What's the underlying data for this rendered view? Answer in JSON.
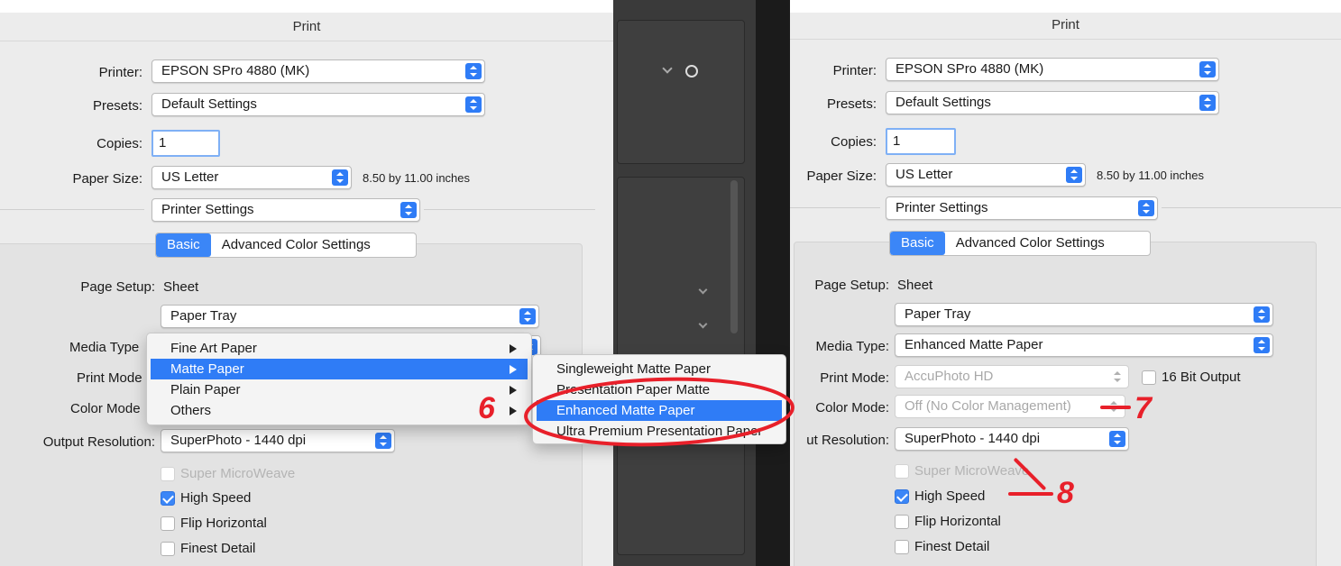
{
  "dialog_title": "Print",
  "labels": {
    "printer": "Printer:",
    "presets": "Presets:",
    "copies": "Copies:",
    "paper_size": "Paper Size:",
    "page_setup": "Page Setup:",
    "media_type": "Media Type:",
    "print_mode": "Print Mode:",
    "color_mode": "Color Mode:",
    "output_resolution": "Output Resolution:"
  },
  "left": {
    "printer": "EPSON SPro 4880 (MK)",
    "presets": "Default Settings",
    "copies": "1",
    "paper_size": "US Letter",
    "paper_dimensions": "8.50 by 11.00 inches",
    "panel_select": "Printer Settings",
    "tabs": [
      "Basic",
      "Advanced Color Settings"
    ],
    "page_setup_value": "Sheet",
    "paper_source": "Paper Tray",
    "media_type_label_clipped": "Media Type",
    "print_mode_label_clipped": "Print Mode",
    "color_mode_label_clipped": "Color Mode",
    "output_resolution": "SuperPhoto - 1440 dpi",
    "options": [
      {
        "label": "Super MicroWeave",
        "checked": false,
        "disabled": true
      },
      {
        "label": "High Speed",
        "checked": true,
        "disabled": false
      },
      {
        "label": "Flip Horizontal",
        "checked": false,
        "disabled": false
      },
      {
        "label": "Finest Detail",
        "checked": false,
        "disabled": false
      }
    ]
  },
  "media_menu": {
    "items": [
      "Fine Art Paper",
      "Matte Paper",
      "Plain Paper",
      "Others"
    ],
    "selected": "Matte Paper"
  },
  "matte_submenu": {
    "items": [
      "Singleweight Matte Paper",
      "Presentation Paper Matte",
      "Enhanced Matte Paper",
      "Ultra Premium Presentation Paper"
    ],
    "selected": "Enhanced Matte Paper"
  },
  "right": {
    "printer": "EPSON SPro 4880 (MK)",
    "presets": "Default Settings",
    "copies": "1",
    "paper_size": "US Letter",
    "paper_dimensions": "8.50 by 11.00 inches",
    "panel_select": "Printer Settings",
    "tabs": [
      "Basic",
      "Advanced Color Settings"
    ],
    "page_setup_value": "Sheet",
    "paper_source": "Paper Tray",
    "media_type": "Enhanced Matte Paper",
    "print_mode": "AccuPhoto HD",
    "bit_output": "16 Bit Output",
    "color_mode": "Off (No Color Management)",
    "output_resolution_label_clipped": "ut Resolution:",
    "output_resolution": "SuperPhoto - 1440 dpi",
    "options": [
      {
        "label": "Super MicroWeave",
        "checked": false,
        "disabled": true
      },
      {
        "label": "High Speed",
        "checked": true,
        "disabled": false
      },
      {
        "label": "Flip Horizontal",
        "checked": false,
        "disabled": false
      },
      {
        "label": "Finest Detail",
        "checked": false,
        "disabled": false
      }
    ]
  },
  "annotations": {
    "step6": "6",
    "step7": "7",
    "step8": "8"
  },
  "colors": {
    "accent": "#2f7cf6",
    "annotation": "#e8202a",
    "dialog_bg": "#ececec"
  }
}
